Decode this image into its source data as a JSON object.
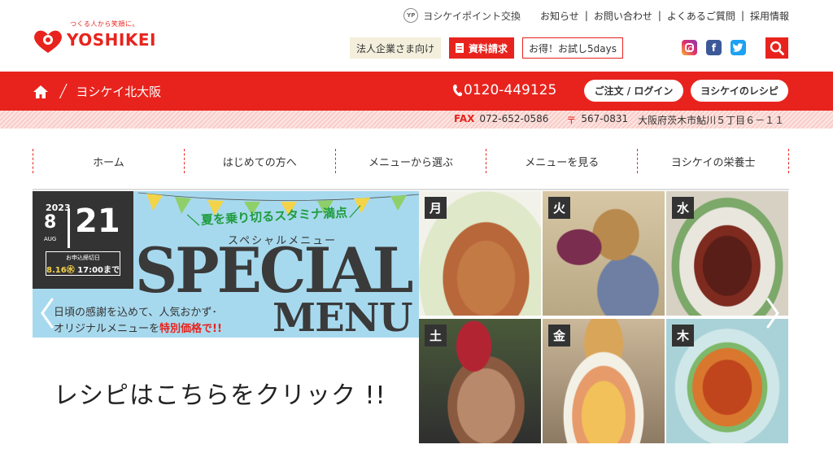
{
  "brand": {
    "tagline": "つくる人から笑顔に。",
    "name": "YOSHIKEI",
    "colors": {
      "primary": "#e8231d",
      "corp_bg": "#f3efdc",
      "banner_blue": "#a7d9ee"
    }
  },
  "top_links": {
    "point_icon": "YP",
    "point_exchange": "ヨシケイポイント交換",
    "news": "お知らせ",
    "contact": "お問い合わせ",
    "faq": "よくあるご質問",
    "recruit": "採用情報",
    "separator": "|"
  },
  "header_buttons": {
    "corporate": "法人企業さま向け",
    "documents": "資料請求",
    "trial": "お得！お試し5days"
  },
  "social": {
    "instagram": "instagram-icon",
    "facebook": "f",
    "twitter": "twitter-icon",
    "search": "search-icon"
  },
  "redbar": {
    "branch": "ヨシケイ北大阪",
    "phone": "0120-449125",
    "order_login": "ご注文 / ログイン",
    "recipe": "ヨシケイのレシピ"
  },
  "fax": {
    "label": "FAX",
    "number": "072-652-0586",
    "postal_mark": "〒",
    "postal_code": "567-0831",
    "address": "大阪府茨木市鮎川５丁目６－１１"
  },
  "nav": {
    "items": [
      "ホーム",
      "はじめての方へ",
      "メニューから選ぶ",
      "メニューを見る",
      "ヨシケイの栄養士"
    ]
  },
  "banner": {
    "year": "2023",
    "month": "8",
    "month_abbr": "AUG",
    "day": "21",
    "deadline_label": "お申込締切日",
    "deadline_date": "8.16",
    "deadline_weekday": "㊌",
    "deadline_time": "17:00まで",
    "headline": "夏を乗り切るスタミナ満点",
    "sub_kana": "スペシャルメニュー",
    "special": "SPECIAL",
    "menu": "MENU",
    "desc_line1": "日頃の感謝を込めて、人気おかず･",
    "desc_line2_a": "オリジナルメニューを",
    "desc_line2_b": "特別価格で!!",
    "click_text": "レシピはこちらをクリック !!",
    "days": [
      "月",
      "火",
      "水",
      "土",
      "金",
      "木"
    ]
  }
}
